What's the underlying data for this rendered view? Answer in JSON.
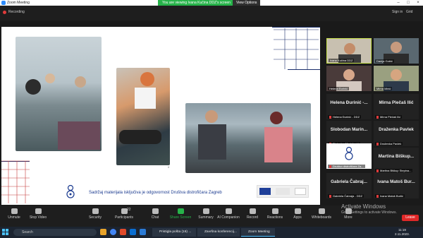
{
  "window": {
    "title": "Zoom Meeting"
  },
  "topbar": {
    "recording": "Recording",
    "banner": "You are viewing Ivana Kučina DDZ's screen",
    "view_options": "View Options",
    "sign_in": "Sign in",
    "grid": "Grid"
  },
  "slide": {
    "caption": "Sadržaj materijala isključiva je odgovornost Društva distrofičara Zagreb",
    "side_mark": "8"
  },
  "participants": [
    {
      "name": "Ivana Kučina DDZ",
      "video": true
    },
    {
      "name": "Danija Gobić",
      "video": true
    },
    {
      "name": "Helena Đurinić",
      "video": true
    },
    {
      "name": "Mirna Minić",
      "video": true
    },
    {
      "name": "Helena Đurinić - DDZ",
      "big": "Helena Đurinić -...",
      "muted": true
    },
    {
      "name": "Mirna Plečaš Ilić",
      "big": "Mirna Plečaš Ilić",
      "muted": true
    },
    {
      "name": "Slobodan Marinković",
      "big": "Slobodan Marin...",
      "muted": true
    },
    {
      "name": "Draženka Pavlek",
      "big": "Draženka Pavlek",
      "muted": true
    },
    {
      "name": "Društvo distrofičara Za...",
      "logo": true,
      "muted": true
    },
    {
      "name": "Martina Biškup Stepina...",
      "big": "Martina Biškup...",
      "muted": true
    },
    {
      "name": "Gabriela Čabraja - DDZ",
      "big": "Gabriela Čabraj...",
      "muted": true
    },
    {
      "name": "Ivana Matoš Burlić",
      "big": "Ivana Matoš Bur...",
      "muted": true
    }
  ],
  "toolbar": {
    "unmute": "Unmute",
    "stop_video": "Stop Video",
    "security": "Security",
    "participants": "Participants",
    "participants_count": "22",
    "chat": "Chat",
    "share_screen": "Share Screen",
    "summary": "Summary",
    "ai_companion": "AI Companion",
    "record": "Record",
    "reactions": "Reactions",
    "apps": "Apps",
    "whiteboards": "Whiteboards",
    "more": "More",
    "leave": "Leave"
  },
  "watermark": {
    "line1": "Activate Windows",
    "line2": "Go to Settings to activate Windows."
  },
  "taskbar": {
    "search": "Search",
    "tasks": [
      "Pristigla pošta (16) ...",
      "Završna konferencij...",
      "Zoom Meeting"
    ],
    "time": "11:19",
    "date": "2.11.2023."
  },
  "colors": {
    "accent_green": "#27b34a",
    "leave_red": "#e02828",
    "zoom_blue": "#2d8cff",
    "slide_text": "#1a3a8f"
  }
}
